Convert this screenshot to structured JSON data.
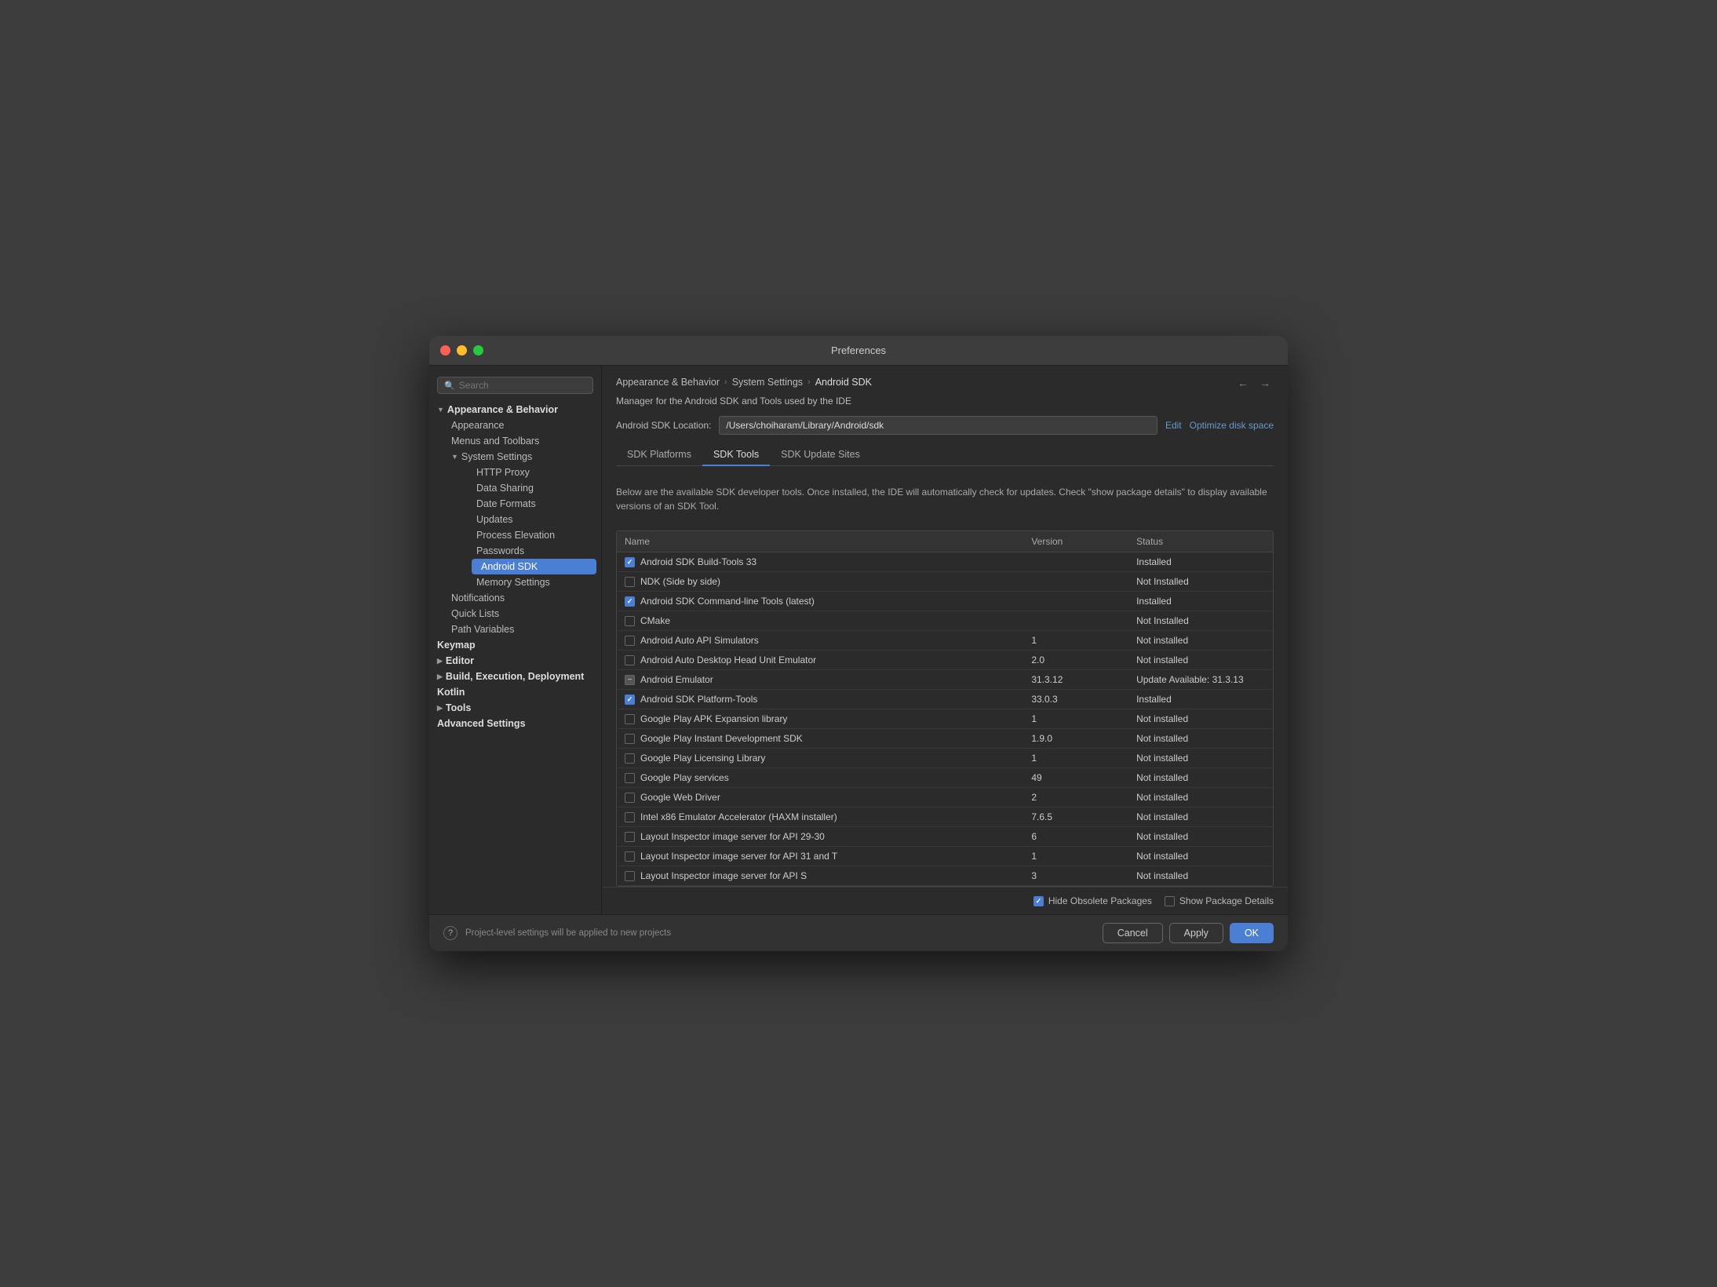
{
  "window": {
    "title": "Preferences"
  },
  "sidebar": {
    "search_placeholder": "Search",
    "sections": [
      {
        "id": "appearance-behavior",
        "label": "Appearance & Behavior",
        "expanded": true,
        "children": [
          {
            "id": "appearance",
            "label": "Appearance",
            "active": false
          },
          {
            "id": "menus-toolbars",
            "label": "Menus and Toolbars",
            "active": false
          },
          {
            "id": "system-settings",
            "label": "System Settings",
            "expanded": true,
            "children": [
              {
                "id": "http-proxy",
                "label": "HTTP Proxy",
                "active": false
              },
              {
                "id": "data-sharing",
                "label": "Data Sharing",
                "active": false
              },
              {
                "id": "date-formats",
                "label": "Date Formats",
                "active": false
              },
              {
                "id": "updates",
                "label": "Updates",
                "active": false
              },
              {
                "id": "process-elevation",
                "label": "Process Elevation",
                "active": false
              },
              {
                "id": "passwords",
                "label": "Passwords",
                "active": false
              },
              {
                "id": "android-sdk",
                "label": "Android SDK",
                "active": true
              },
              {
                "id": "memory-settings",
                "label": "Memory Settings",
                "active": false
              }
            ]
          },
          {
            "id": "notifications",
            "label": "Notifications",
            "active": false
          },
          {
            "id": "quick-lists",
            "label": "Quick Lists",
            "active": false
          },
          {
            "id": "path-variables",
            "label": "Path Variables",
            "active": false
          }
        ]
      },
      {
        "id": "keymap",
        "label": "Keymap",
        "expanded": false
      },
      {
        "id": "editor",
        "label": "Editor",
        "expanded": false
      },
      {
        "id": "build-execution",
        "label": "Build, Execution, Deployment",
        "expanded": false
      },
      {
        "id": "kotlin",
        "label": "Kotlin"
      },
      {
        "id": "tools",
        "label": "Tools",
        "expanded": false
      },
      {
        "id": "advanced-settings",
        "label": "Advanced Settings"
      }
    ]
  },
  "breadcrumb": {
    "items": [
      "Appearance & Behavior",
      "System Settings",
      "Android SDK"
    ]
  },
  "content": {
    "description": "Manager for the Android SDK and Tools used by the IDE",
    "sdk_location_label": "Android SDK Location:",
    "sdk_location_value": "/Users/choiharam/Library/Android/sdk",
    "edit_label": "Edit",
    "optimize_label": "Optimize disk space",
    "tabs": [
      {
        "id": "sdk-platforms",
        "label": "SDK Platforms",
        "active": false
      },
      {
        "id": "sdk-tools",
        "label": "SDK Tools",
        "active": true
      },
      {
        "id": "sdk-update-sites",
        "label": "SDK Update Sites",
        "active": false
      }
    ],
    "table_description": "Below are the available SDK developer tools. Once installed, the IDE will automatically check\nfor updates. Check \"show package details\" to display available versions of an SDK Tool.",
    "table": {
      "headers": [
        "Name",
        "Version",
        "Status"
      ],
      "rows": [
        {
          "checked": "checked",
          "name": "Android SDK Build-Tools 33",
          "version": "",
          "status": "Installed"
        },
        {
          "checked": "unchecked",
          "name": "NDK (Side by side)",
          "version": "",
          "status": "Not Installed"
        },
        {
          "checked": "checked",
          "name": "Android SDK Command-line Tools (latest)",
          "version": "",
          "status": "Installed"
        },
        {
          "checked": "unchecked",
          "name": "CMake",
          "version": "",
          "status": "Not Installed"
        },
        {
          "checked": "unchecked",
          "name": "Android Auto API Simulators",
          "version": "1",
          "status": "Not installed"
        },
        {
          "checked": "unchecked",
          "name": "Android Auto Desktop Head Unit Emulator",
          "version": "2.0",
          "status": "Not installed"
        },
        {
          "checked": "partial",
          "name": "Android Emulator",
          "version": "31.3.12",
          "status": "Update Available: 31.3.13"
        },
        {
          "checked": "checked",
          "name": "Android SDK Platform-Tools",
          "version": "33.0.3",
          "status": "Installed"
        },
        {
          "checked": "unchecked",
          "name": "Google Play APK Expansion library",
          "version": "1",
          "status": "Not installed"
        },
        {
          "checked": "unchecked",
          "name": "Google Play Instant Development SDK",
          "version": "1.9.0",
          "status": "Not installed"
        },
        {
          "checked": "unchecked",
          "name": "Google Play Licensing Library",
          "version": "1",
          "status": "Not installed"
        },
        {
          "checked": "unchecked",
          "name": "Google Play services",
          "version": "49",
          "status": "Not installed"
        },
        {
          "checked": "unchecked",
          "name": "Google Web Driver",
          "version": "2",
          "status": "Not installed"
        },
        {
          "checked": "unchecked",
          "name": "Intel x86 Emulator Accelerator (HAXM installer)",
          "version": "7.6.5",
          "status": "Not installed"
        },
        {
          "checked": "unchecked",
          "name": "Layout Inspector image server for API 29-30",
          "version": "6",
          "status": "Not installed"
        },
        {
          "checked": "unchecked",
          "name": "Layout Inspector image server for API 31 and T",
          "version": "1",
          "status": "Not installed"
        },
        {
          "checked": "unchecked",
          "name": "Layout Inspector image server for API S",
          "version": "3",
          "status": "Not installed"
        }
      ]
    },
    "bottom_options": {
      "hide_obsolete_checked": true,
      "hide_obsolete_label": "Hide Obsolete Packages",
      "show_details_checked": false,
      "show_details_label": "Show Package Details"
    }
  },
  "footer": {
    "help_label": "?",
    "note": "Project-level settings will be applied to new projects",
    "buttons": {
      "cancel": "Cancel",
      "apply": "Apply",
      "ok": "OK"
    }
  }
}
